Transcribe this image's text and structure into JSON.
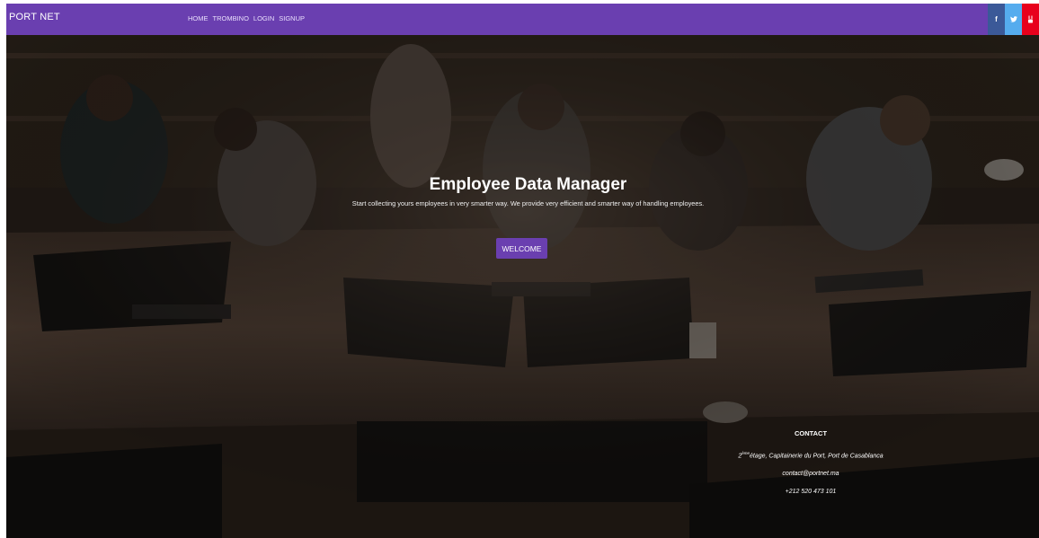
{
  "navbar": {
    "brand": "PORT NET",
    "links": [
      "HOME",
      "TROMBINO",
      "LOGIN",
      "SIGNUP"
    ],
    "social": [
      {
        "icon": "facebook-icon",
        "glyph": "f",
        "color": "#3b5998"
      },
      {
        "icon": "twitter-icon",
        "glyph": "t",
        "color": "#55acee"
      },
      {
        "icon": "youtube-icon",
        "glyph": "yt",
        "color": "#e8001c"
      }
    ],
    "color": "#6a3fb0"
  },
  "hero": {
    "title": "Employee Data Manager",
    "subtitle": "Start collecting yours employees in very smarter way. We provide very efficient and smarter way of handling employees.",
    "button_label": "WELCOME",
    "button_color": "#6a3fb0"
  },
  "contact": {
    "title": "CONTACT",
    "address_sup": "ème",
    "address_rest": "étage, Capitainerie du Port, Port de Casablanca",
    "address_prefix": "2",
    "email": "contact@portnet.ma",
    "phone": "+212 520 473 101"
  }
}
